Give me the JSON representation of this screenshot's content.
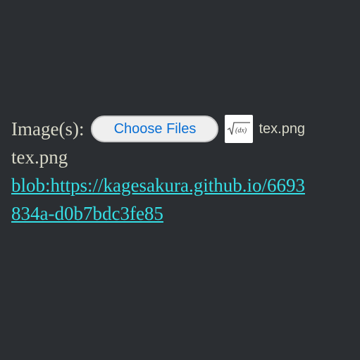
{
  "form": {
    "label": "Image(s):",
    "choose_button": "Choose Files",
    "selected_file_name": "tex.png",
    "thumbnail_icon": "formula-thumbnail-icon"
  },
  "output": {
    "file_name": "tex.png",
    "blob_url": "blob:https://kagesakura.github.io/6693",
    "blob_url_cont": "834a-d0b7bdc3fe85"
  },
  "colors": {
    "background": "#2b2e32",
    "text": "#d8d8c8",
    "link": "#35dfe6",
    "button_text": "#0a6fd4"
  }
}
